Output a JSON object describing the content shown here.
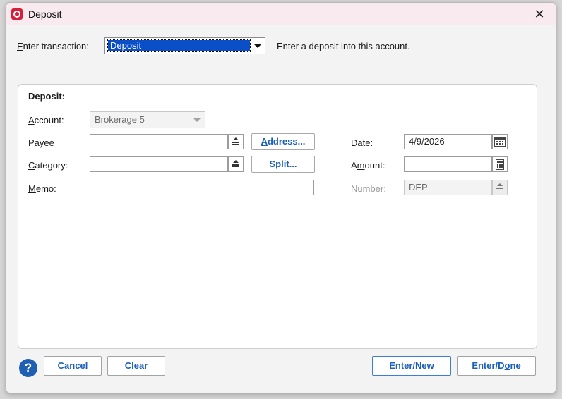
{
  "window": {
    "title": "Deposit",
    "close_glyph": "✕",
    "app_icon": "quicken-logo-icon"
  },
  "transaction": {
    "label_prefix": "E",
    "label_rest": "nter transaction:",
    "selected": "Deposit",
    "description": "Enter a deposit into this account."
  },
  "panel": {
    "heading": "Deposit:",
    "account": {
      "label_u": "A",
      "label_rest": "ccount:",
      "value": "Brokerage 5"
    },
    "payee": {
      "label_u": "P",
      "label_rest": "ayee",
      "value": "",
      "button_u": "A",
      "button_rest": "ddress..."
    },
    "category": {
      "label_u": "C",
      "label_rest": "ategory:",
      "value": "",
      "button_u": "S",
      "button_rest": "plit..."
    },
    "memo": {
      "label_u": "M",
      "label_rest": "emo:",
      "value": ""
    },
    "date": {
      "label_u": "D",
      "label_rest": "ate:",
      "value": "4/9/2026"
    },
    "amount": {
      "label_pre": "A",
      "label_u": "m",
      "label_rest": "ount:",
      "value": ""
    },
    "number": {
      "label": "Number:",
      "value": "DEP"
    }
  },
  "footer": {
    "help": "?",
    "cancel": "Cancel",
    "clear": "Clear",
    "enter_new": "Enter/New",
    "enter_done_pre": "Enter/D",
    "enter_done_u": "o",
    "enter_done_rest": "ne"
  }
}
